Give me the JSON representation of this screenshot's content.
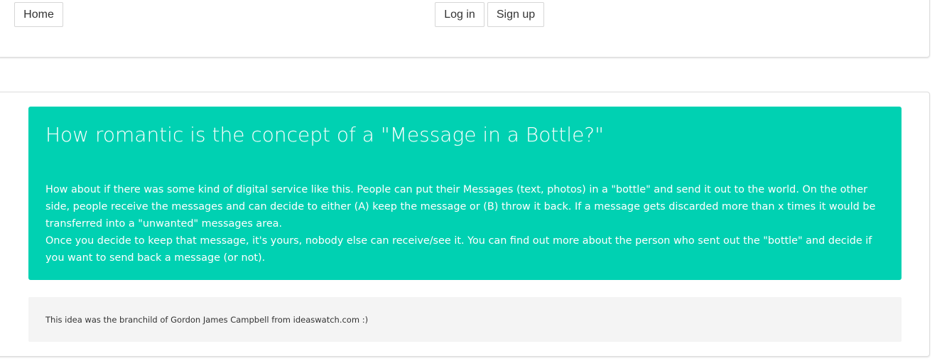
{
  "navbar": {
    "home_label": "Home",
    "login_label": "Log in",
    "signup_label": "Sign up"
  },
  "idea": {
    "title": "How romantic is the concept of a \"Message in a Bottle?\"",
    "paragraph_1": "How about if there was some kind of digital service like this. People can put their Messages (text, photos) in a \"bottle\" and send it out to the world. On the other side, people receive the messages and can decide to either (A) keep the message or (B) throw it back. If a message gets discarded more than x times it would be transferred into a \"unwanted\" messages area.",
    "paragraph_2": "Once you decide to keep that message, it's yours, nobody else can receive/see it. You can find out more about the person who sent out the \"bottle\" and decide if you want to send back a message (or not).",
    "credit": "This idea was the branchild of Gordon James Campbell from ideaswatch.com :)"
  },
  "colors": {
    "accent": "#00d1b2",
    "credit_background": "#f4f4f4",
    "border": "#dddddd"
  }
}
